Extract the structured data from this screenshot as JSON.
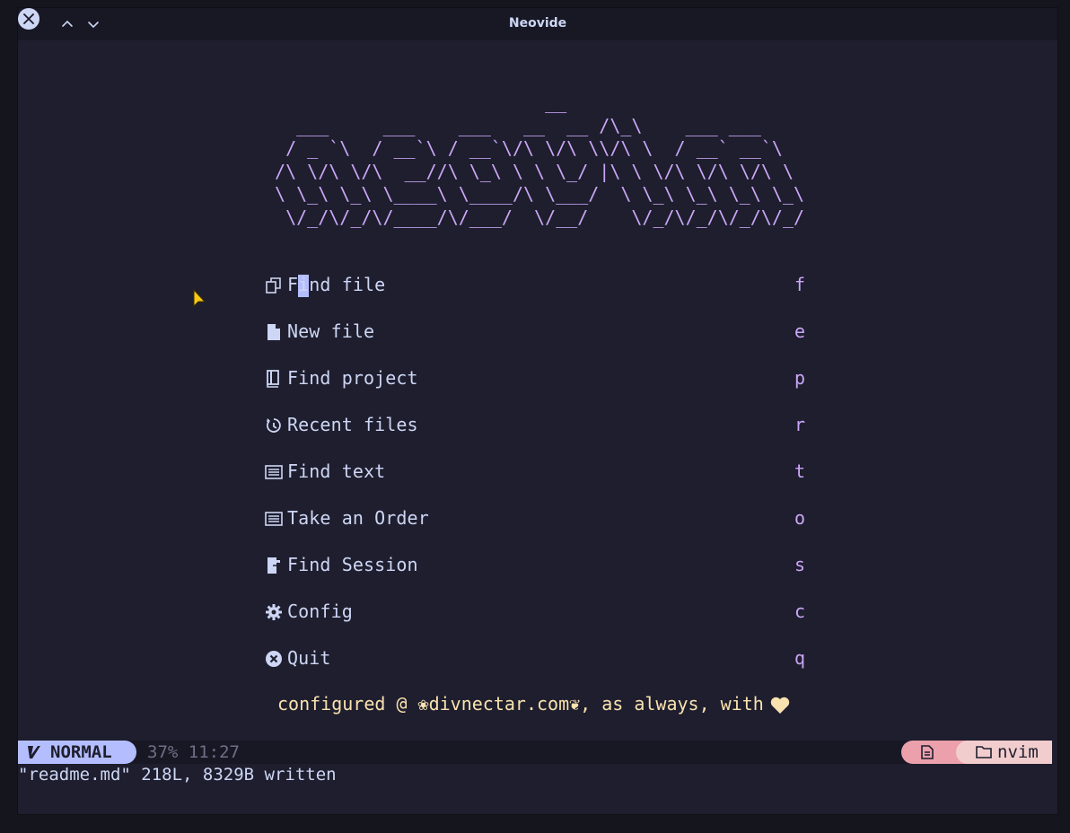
{
  "window": {
    "title": "Neovide"
  },
  "dashboard": {
    "ascii_logo": "                          __\n   ___     ___    ___   __  __ /\\_\\    ___ ___\n  / _ `\\  / __`\\ / __`\\/\\ \\/\\ \\\\/\\ \\  / __` __`\\\n /\\ \\/\\ \\/\\  __//\\ \\_\\ \\ \\ \\_/ |\\ \\ \\/\\ \\/\\ \\/\\ \\\n \\ \\_\\ \\_\\ \\____\\ \\____/\\ \\___/  \\ \\_\\ \\_\\ \\_\\ \\_\\\n  \\/_/\\/_/\\/____/\\/___/  \\/__/    \\/_/\\/_/\\/_/\\/_/",
    "items": [
      {
        "icon": "copy-icon",
        "label": "Find file",
        "key": "f"
      },
      {
        "icon": "file-icon",
        "label": "New file",
        "key": "e"
      },
      {
        "icon": "book-icon",
        "label": "Find project",
        "key": "p"
      },
      {
        "icon": "history-icon",
        "label": "Recent files",
        "key": "r"
      },
      {
        "icon": "text-list-icon",
        "label": "Find text",
        "key": "t"
      },
      {
        "icon": "list-icon",
        "label": "Take an Order",
        "key": "o"
      },
      {
        "icon": "session-icon",
        "label": "Find Session",
        "key": "s"
      },
      {
        "icon": "gear-icon",
        "label": "Config",
        "key": "c"
      },
      {
        "icon": "close-circle-icon",
        "label": "Quit",
        "key": "q"
      }
    ],
    "footer": "configured @ ❀divnectar.com❦, as always, with"
  },
  "statusline": {
    "mode": "NORMAL",
    "position": "37% 11:27",
    "directory": "nvim"
  },
  "cmdline": {
    "message": "\"readme.md\" 218L, 8329B written"
  },
  "colors": {
    "background": "#1e1e2e",
    "text": "#cdd6f4",
    "accent": "#cba6f7",
    "mode_bg": "#b4befe",
    "footer": "#f9e2af",
    "file_pill": "#eba0ac",
    "dir_pill": "#f2cdcd"
  }
}
